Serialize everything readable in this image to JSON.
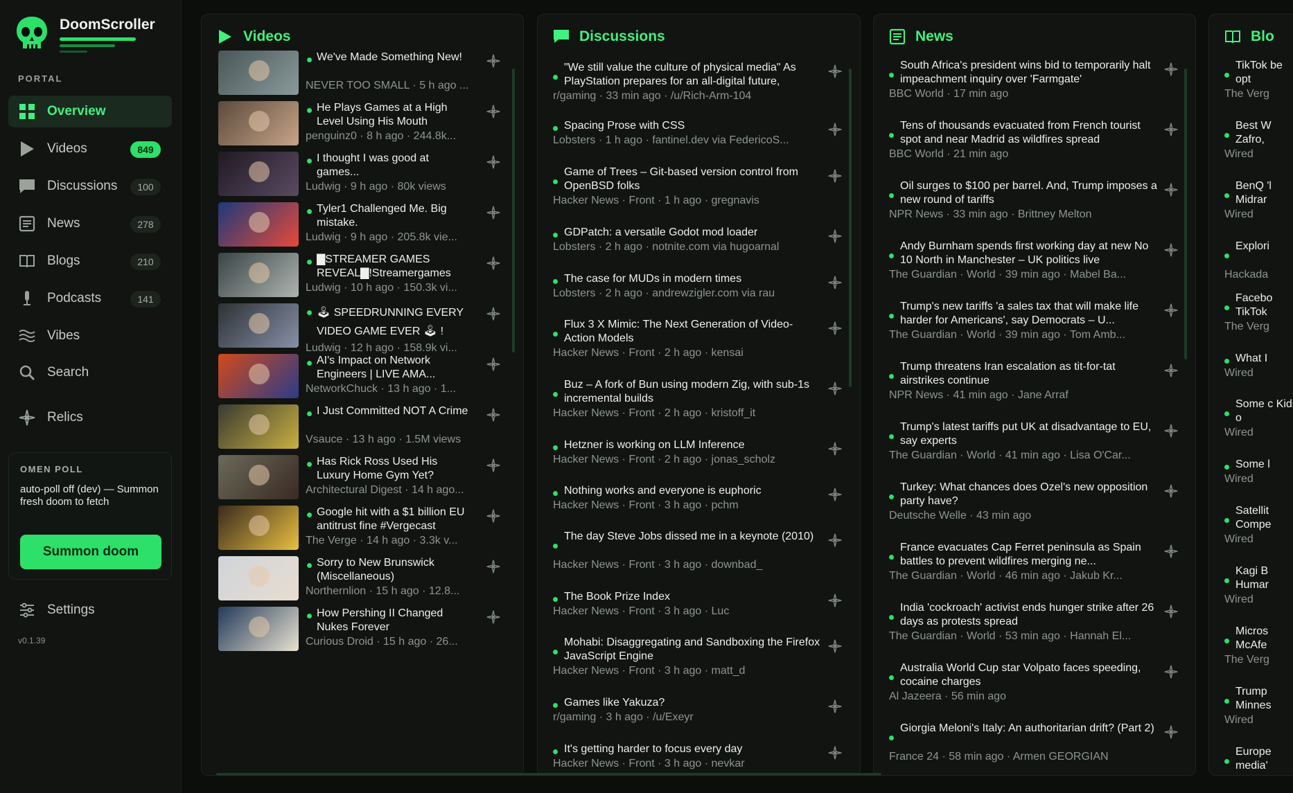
{
  "app": {
    "name": "DoomScroller",
    "section_label": "PORTAL",
    "version": "v0.1.39",
    "accent": "#2ce06a"
  },
  "nav": {
    "overview": {
      "label": "Overview",
      "icon": "grid-icon"
    },
    "videos": {
      "label": "Videos",
      "icon": "play-icon",
      "count": "849"
    },
    "discussions": {
      "label": "Discussions",
      "icon": "chat-icon",
      "count": "100"
    },
    "news": {
      "label": "News",
      "icon": "newspaper-icon",
      "count": "278"
    },
    "blogs": {
      "label": "Blogs",
      "icon": "book-icon",
      "count": "210"
    },
    "podcasts": {
      "label": "Podcasts",
      "icon": "microphone-icon",
      "count": "141"
    },
    "vibes": {
      "label": "Vibes",
      "icon": "waves-icon"
    },
    "search": {
      "label": "Search",
      "icon": "search-icon"
    },
    "relics": {
      "label": "Relics",
      "icon": "relic-icon"
    },
    "settings": {
      "label": "Settings",
      "icon": "sliders-icon"
    }
  },
  "poll": {
    "title": "OMEN POLL",
    "text": "auto-poll off (dev) — Summon fresh doom to fetch",
    "button": "Summon doom"
  },
  "columns": {
    "videos": {
      "title": "Videos",
      "items": [
        {
          "title": "We've Made Something New!",
          "meta": "NEVER TOO SMALL · 5 h ago ..."
        },
        {
          "title": "He Plays Games at a High Level Using His Mouth",
          "meta": "penguinz0 · 8 h ago · 244.8k..."
        },
        {
          "title": "I thought I was good at games...",
          "meta": "Ludwig · 9 h ago · 80k views"
        },
        {
          "title": "Tyler1 Challenged Me. Big mistake.",
          "meta": "Ludwig · 9 h ago · 205.8k vie..."
        },
        {
          "title": "▇STREAMER GAMES REVEAL▇!Streamergames",
          "meta": "Ludwig · 10 h ago · 150.3k vi..."
        },
        {
          "title": "🕹 SPEEDRUNNING EVERY VIDEO GAME EVER 🕹 !",
          "meta": "Ludwig · 12 h ago · 158.9k vi..."
        },
        {
          "title": "AI's Impact on Network Engineers | LIVE AMA...",
          "meta": "NetworkChuck · 13 h ago · 1..."
        },
        {
          "title": "I Just Committed NOT A Crime",
          "meta": "Vsauce · 13 h ago · 1.5M views"
        },
        {
          "title": "Has Rick Ross Used His Luxury Home Gym Yet?",
          "meta": "Architectural Digest · 14 h ago..."
        },
        {
          "title": "Google hit with a $1 billion EU antitrust fine #Vergecast",
          "meta": "The Verge · 14 h ago · 3.3k v..."
        },
        {
          "title": "Sorry to New Brunswick (Miscellaneous)",
          "meta": "Northernlion · 15 h ago · 12.8..."
        },
        {
          "title": "How Pershing II Changed Nukes Forever",
          "meta": "Curious Droid · 15 h ago · 26..."
        }
      ]
    },
    "discussions": {
      "title": "Discussions",
      "items": [
        {
          "title": "\"We still value the culture of physical media\" As PlayStation prepares for an all-digital future,",
          "meta": "r/gaming · 33 min ago · /u/Rich-Arm-104"
        },
        {
          "title": "Spacing Prose with CSS",
          "meta": "Lobsters · 1 h ago · fantinel.dev via FedericoS..."
        },
        {
          "title": "Game of Trees – Git-based version control from OpenBSD folks",
          "meta": "Hacker News · Front · 1 h ago · gregnavis"
        },
        {
          "title": "GDPatch: a versatile Godot mod loader",
          "meta": "Lobsters · 2 h ago · notnite.com via hugoarnal"
        },
        {
          "title": "The case for MUDs in modern times",
          "meta": "Lobsters · 2 h ago · andrewzigler.com via rau"
        },
        {
          "title": "Flux 3 X Mimic: The Next Generation of Video-Action Models",
          "meta": "Hacker News · Front · 2 h ago · kensai"
        },
        {
          "title": "Buz – A fork of Bun using modern Zig, with sub-1s incremental builds",
          "meta": "Hacker News · Front · 2 h ago · kristoff_it"
        },
        {
          "title": "Hetzner is working on LLM Inference",
          "meta": "Hacker News · Front · 2 h ago · jonas_scholz"
        },
        {
          "title": "Nothing works and everyone is euphoric",
          "meta": "Hacker News · Front · 3 h ago · pchm"
        },
        {
          "title": "The day Steve Jobs dissed me in a keynote (2010)",
          "meta": "Hacker News · Front · 3 h ago · downbad_"
        },
        {
          "title": "The Book Prize Index",
          "meta": "Hacker News · Front · 3 h ago · Luc"
        },
        {
          "title": "Mohabi: Disaggregating and Sandboxing the Firefox JavaScript Engine",
          "meta": "Hacker News · Front · 3 h ago · matt_d"
        },
        {
          "title": "Games like Yakuza?",
          "meta": "r/gaming · 3 h ago · /u/Exeyr"
        },
        {
          "title": "It's getting harder to focus every day",
          "meta": "Hacker News · Front · 3 h ago · nevkar"
        }
      ]
    },
    "news": {
      "title": "News",
      "items": [
        {
          "title": "South Africa's president wins bid to temporarily halt impeachment inquiry over 'Farmgate'",
          "meta": "BBC World · 17 min ago"
        },
        {
          "title": "Tens of thousands evacuated from French tourist spot and near Madrid as wildfires spread",
          "meta": "BBC World · 21 min ago"
        },
        {
          "title": "Oil surges to $100 per barrel. And, Trump imposes a new round of tariffs",
          "meta": "NPR News · 33 min ago · Brittney Melton"
        },
        {
          "title": "Andy Burnham spends first working day at new No 10 North in Manchester – UK politics live",
          "meta": "The Guardian · World · 39 min ago · Mabel Ba..."
        },
        {
          "title": "Trump's new tariffs 'a sales tax that will make life harder for Americans', say Democrats – U...",
          "meta": "The Guardian · World · 39 min ago · Tom Amb..."
        },
        {
          "title": "Trump threatens Iran escalation as tit-for-tat airstrikes continue",
          "meta": "NPR News · 41 min ago · Jane Arraf"
        },
        {
          "title": "Trump's latest tariffs put UK at disadvantage to EU, say experts",
          "meta": "The Guardian · World · 41 min ago · Lisa O'Car..."
        },
        {
          "title": "Turkey: What chances does Ozel's new opposition party have?",
          "meta": "Deutsche Welle · 43 min ago"
        },
        {
          "title": "France evacuates Cap Ferret peninsula as Spain battles to prevent wildfires merging ne...",
          "meta": "The Guardian · World · 46 min ago · Jakub Kr..."
        },
        {
          "title": "India 'cockroach' activist ends hunger strike after 26 days as protests spread",
          "meta": "The Guardian · World · 53 min ago · Hannah El..."
        },
        {
          "title": "Australia World Cup star Volpato faces speeding, cocaine charges",
          "meta": "Al Jazeera · 56 min ago"
        },
        {
          "title": "Giorgia Meloni's Italy: An authoritarian drift? (Part 2)",
          "meta": "France 24 · 58 min ago · Armen GEORGIAN"
        }
      ]
    },
    "blogs": {
      "title": "Blo",
      "items": [
        {
          "title": "TikTok be opt",
          "meta": "The Verg"
        },
        {
          "title": "Best W Zafro,",
          "meta": "Wired"
        },
        {
          "title": "BenQ 'l Midrar",
          "meta": "Wired"
        },
        {
          "title": "Explori",
          "meta": "Hackada"
        },
        {
          "title": "Facebo TikTok",
          "meta": "The Verg"
        },
        {
          "title": "What I",
          "meta": "Wired"
        },
        {
          "title": "Some c Kids o",
          "meta": "Wired"
        },
        {
          "title": "Some l",
          "meta": "Wired"
        },
        {
          "title": "Satellit Compe",
          "meta": "Wired"
        },
        {
          "title": "Kagi B Humar",
          "meta": "Wired"
        },
        {
          "title": "Micros McAfe",
          "meta": "The Verg"
        },
        {
          "title": "Trump Minnes",
          "meta": "Wired"
        },
        {
          "title": "Europe media'",
          "meta": ""
        }
      ]
    }
  }
}
